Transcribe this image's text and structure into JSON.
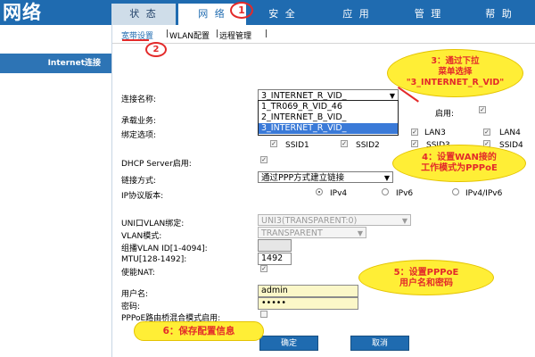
{
  "brand": "网络",
  "nav": {
    "tabs": [
      {
        "label": "状 态"
      },
      {
        "label": "网 络"
      },
      {
        "label": "安 全"
      },
      {
        "label": "应 用"
      },
      {
        "label": "管 理"
      },
      {
        "label": "帮 助"
      }
    ]
  },
  "subnav": {
    "broadband": "宽带设置",
    "wlan": "WLAN配置",
    "remote": "远程管理",
    "sep": "|"
  },
  "sidebar": {
    "selected": "Internet连接"
  },
  "form": {
    "conn_name_label": "连接名称:",
    "conn_name_value": "3_INTERNET_R_VID_",
    "conn_options": [
      "1_TR069_R_VID_46",
      "2_INTERNET_B_VID_",
      "3_INTERNET_R_VID_"
    ],
    "enable_label": "启用:",
    "service_label": "承载业务:",
    "bind_label": "绑定选项:",
    "lan_ports": [
      "LAN3",
      "LAN4"
    ],
    "ssids": [
      "SSID1",
      "SSID2",
      "SSID3",
      "SSID4"
    ],
    "dhcp_label": "DHCP Server启用:",
    "link_label": "链接方式:",
    "link_value": "通过PPP方式建立链接",
    "ip_label": "IP协议版本:",
    "ip_options": [
      "IPv4",
      "IPv6",
      "IPv4/IPv6"
    ],
    "uni_label": "UNI口VLAN绑定:",
    "uni_value": "UNI3(TRANSPARENT:0)",
    "vlan_mode_label": "VLAN模式:",
    "vlan_mode_value": "TRANSPARENT",
    "mcast_label": "组播VLAN ID[1-4094]:",
    "mtu_label": "MTU[128-1492]:",
    "mtu_value": "1492",
    "nat_label": "使能NAT:",
    "user_label": "用户名:",
    "user_value": "admin",
    "pass_label": "密码:",
    "pass_value": "•••••",
    "pppoe_bridge_label": "PPPoE路由桥混合模式启用:"
  },
  "buttons": {
    "confirm": "确定",
    "cancel": "取消"
  },
  "callouts": {
    "c1": "1",
    "c2": "2",
    "c3_line1": "3：通过下拉",
    "c3_line2": "菜单选择",
    "c3_line3": "\"3_INTERNET_R_VID\"",
    "c4_line1": "4：设置WAN接的",
    "c4_line2": "工作模式为PPPoE",
    "c5_line1": "5：设置PPPoE",
    "c5_line2": "用户名和密码",
    "c6": "6：保存配置信息"
  },
  "colors": {
    "header_blue": "#1f6bb0",
    "callout_red": "#e32a2a",
    "callout_yellow": "#ffee36"
  }
}
